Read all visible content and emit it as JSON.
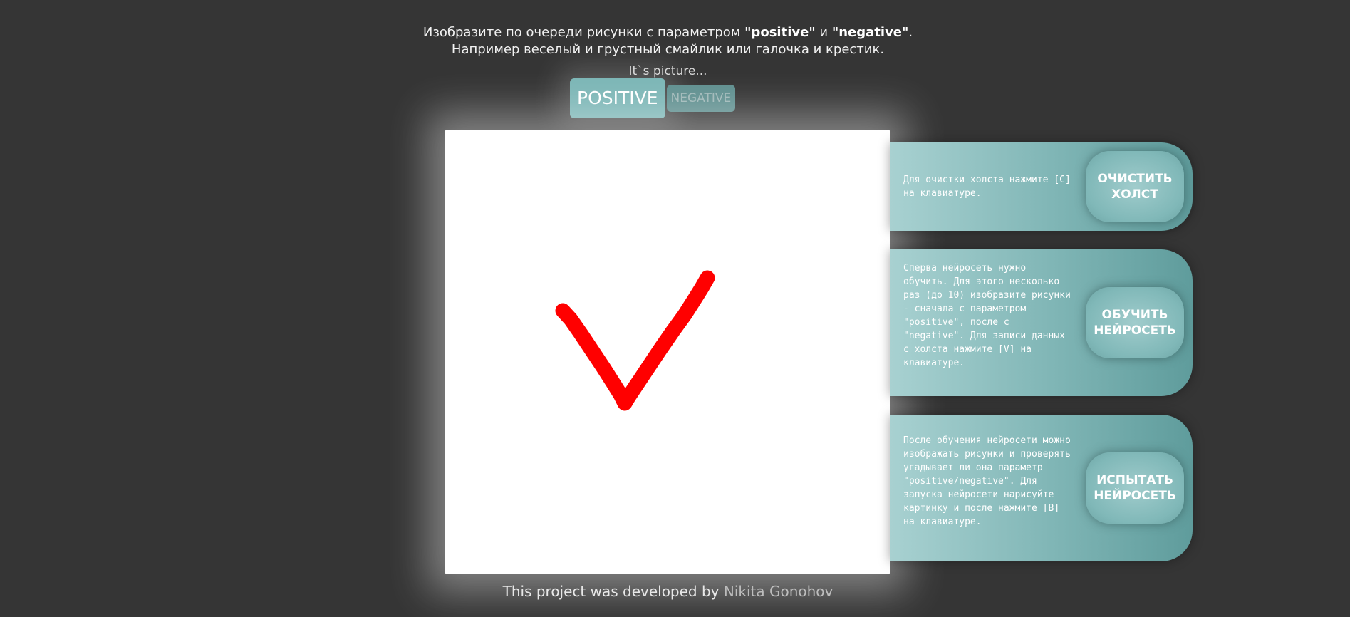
{
  "intro": {
    "line1_prefix": "Изобразите по очереди рисунки с параметром ",
    "line1_positive": "\"positive\"",
    "line1_and": " и ",
    "line1_negative": "\"negative\"",
    "line1_suffix": ".",
    "line2": "Например веселый и грустный смайлик или галочка и крестик."
  },
  "picture_label": "It`s picture...",
  "mode": {
    "positive_label": "POSITIVE",
    "negative_label": "NEGATIVE",
    "selected": "positive"
  },
  "colors": {
    "background": "#353535",
    "accent": "#7cb6b6",
    "stroke": "#ff0000"
  },
  "panels": [
    {
      "text": "Для очистки холста нажмите [C] на клавиатуре.",
      "button": "ОЧИСТИТЬ\nХОЛСТ"
    },
    {
      "text": "Сперва нейросеть нужно обучить. Для этого несколько раз (до 10) изобразите рисунки - сначала с параметром \"positive\", после с \"negative\". Для записи данных с холста нажмите [V] на клавиатуре.",
      "button": "ОБУЧИТЬ\nНЕЙРОСЕТЬ"
    },
    {
      "text": "После обучения нейросети можно изображать рисунки и проверять угадывает ли она параметр \"positive/negative\". Для запуска нейросети нарисуйте картинку и после нажмите [B] на клавиатуре.",
      "button": "ИСПЫТАТЬ\nНЕЙРОСЕТЬ"
    }
  ],
  "footer": {
    "prefix": "This project was developed by ",
    "author": "Nikita Gonohov"
  }
}
